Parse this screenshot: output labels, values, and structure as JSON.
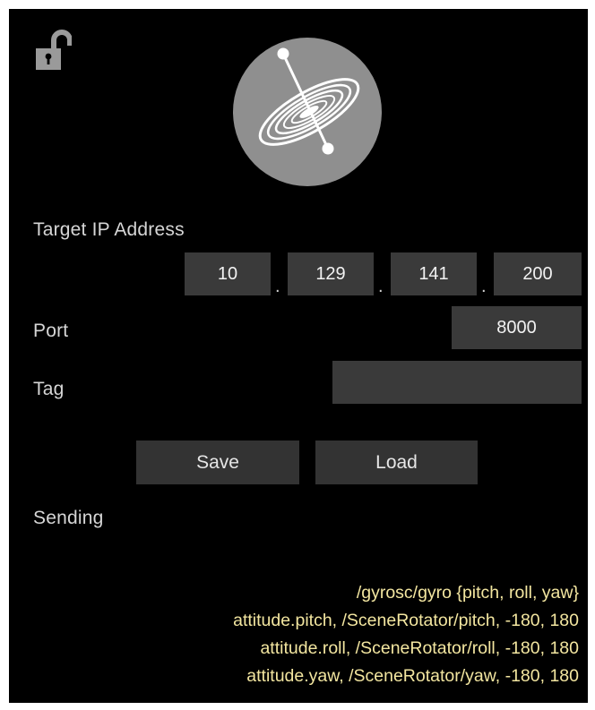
{
  "colors": {
    "background": "#000000",
    "field": "#3a3a3a",
    "button": "#333333",
    "mapping_text": "#f3e6a0",
    "label_text": "#d6d6d6"
  },
  "header": {
    "lock_icon": "unlocked-padlock-icon",
    "logo_icon": "gyro-orbit-logo-icon"
  },
  "form": {
    "ip_label": "Target IP Address",
    "ip_octets": [
      "10",
      "129",
      "141",
      "200"
    ],
    "ip_separator": ".",
    "port_label": "Port",
    "port_value": "8000",
    "tag_label": "Tag",
    "tag_value": ""
  },
  "actions": {
    "save_label": "Save",
    "load_label": "Load"
  },
  "status": {
    "sending_label": "Sending"
  },
  "mappings": [
    "/gyrosc/gyro {pitch, roll, yaw}",
    "attitude.pitch, /SceneRotator/pitch, -180, 180",
    "attitude.roll, /SceneRotator/roll, -180, 180",
    "attitude.yaw, /SceneRotator/yaw, -180, 180"
  ]
}
